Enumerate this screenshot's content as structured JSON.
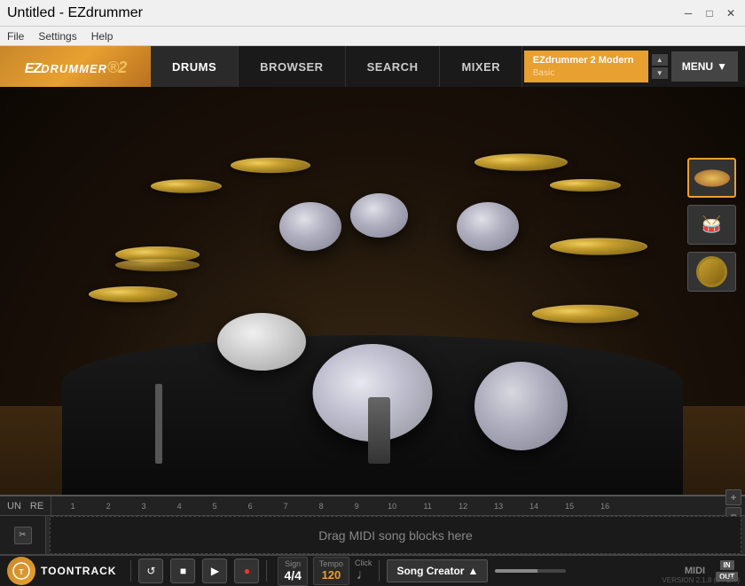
{
  "window": {
    "title": "Untitled - EZdrummer"
  },
  "menubar": {
    "items": [
      "File",
      "Settings",
      "Help"
    ]
  },
  "logo": {
    "text": "EZ DRUMMER",
    "version": "2"
  },
  "nav": {
    "tabs": [
      {
        "id": "drums",
        "label": "DRUMS",
        "active": true
      },
      {
        "id": "browser",
        "label": "BROWSER",
        "active": false
      },
      {
        "id": "search",
        "label": "SEARCH",
        "active": false
      },
      {
        "id": "mixer",
        "label": "MIXER",
        "active": false
      }
    ]
  },
  "preset": {
    "name": "EZdrummer 2 Modern",
    "sub": "Basic"
  },
  "menu_btn": "MENU",
  "timeline": {
    "undo_label": "UN",
    "redo_label": "RE",
    "ruler_ticks": [
      "1",
      "2",
      "3",
      "4",
      "5",
      "6",
      "7",
      "8",
      "9",
      "10",
      "11",
      "12",
      "13",
      "14",
      "15",
      "16"
    ],
    "drop_text": "Drag MIDI song blocks here"
  },
  "transport": {
    "loop_btn": "↺",
    "stop_btn": "■",
    "play_btn": "▶",
    "record_btn": "●",
    "sign_label": "Sign",
    "sign_value": "4/4",
    "tempo_label": "Tempo",
    "tempo_value": "120",
    "click_label": "Click",
    "click_icon": "♩",
    "song_creator_label": "Song Creator",
    "song_creator_arrow": "▲",
    "midi_label": "MIDI",
    "in_label": "IN",
    "out_label": "OUT",
    "version": "VERSION 2.1.8 (64-BIT)"
  },
  "accessories": [
    {
      "id": "acc1",
      "label": "cymbal-detail-1",
      "active": true
    },
    {
      "id": "acc2",
      "label": "stick-detail",
      "active": false
    },
    {
      "id": "acc3",
      "label": "tambourine-detail",
      "active": false
    }
  ],
  "colors": {
    "accent": "#e8a030",
    "bg_dark": "#1a1a1a",
    "bg_mid": "#2a2a2a",
    "text_light": "#ffffff",
    "text_dim": "#888888"
  }
}
